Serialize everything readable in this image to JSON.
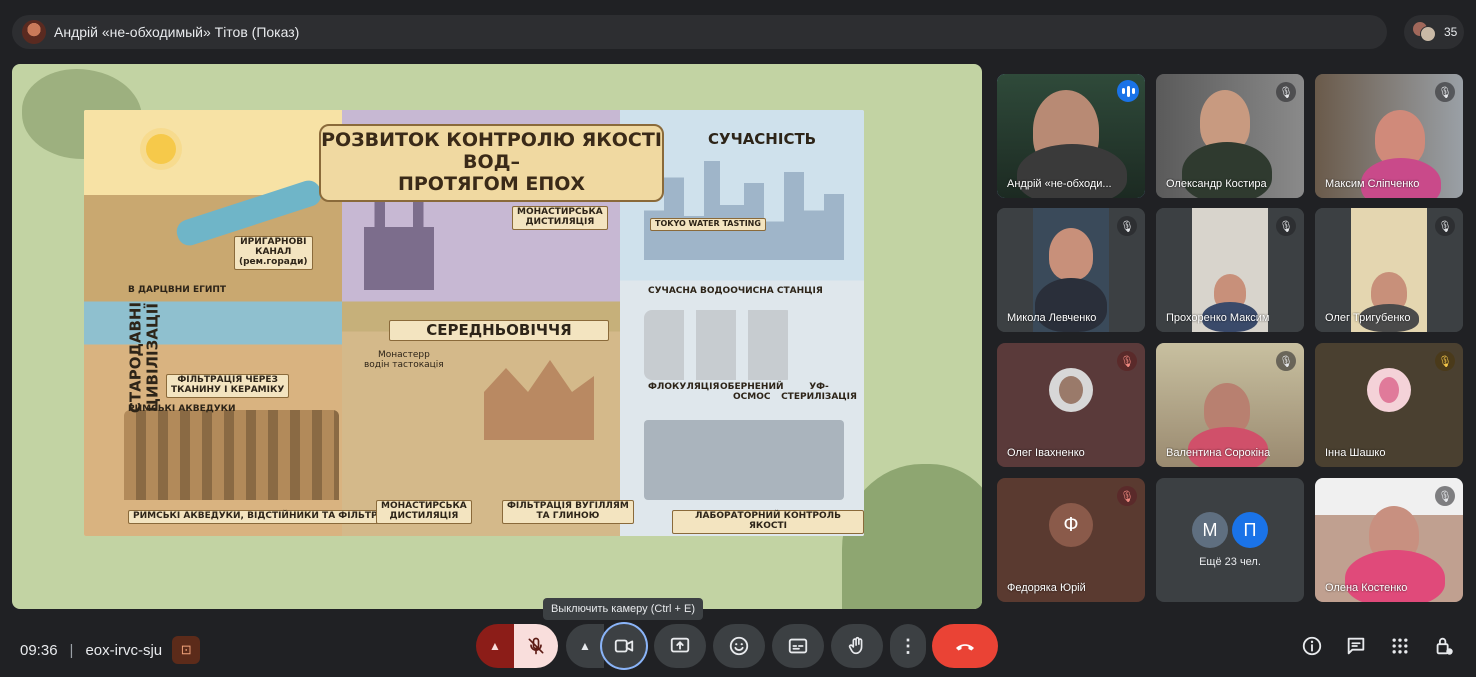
{
  "topbar": {
    "presenter_title": "Андрій «не-обходимый» Тітов (Показ)",
    "participant_count": "35"
  },
  "slide": {
    "title_line1": "РОЗВИТОК КОНТРОЛЮ ЯКОСТІ ВОД–",
    "title_line2": "ПРОТЯГОМ ЕПОХ",
    "section_modern": "СУЧАСНІСТЬ",
    "section_middle": "СЕРЕДНЬОВІЧЧЯ",
    "section_ancient": "СТАРОДАВНІ ЦИВІЛІЗАЦІЇ",
    "labels": {
      "irrigation": "ИРИГАРНОВІ\nКАНАЛ\n(рем.горади)",
      "egypt": "В ДАРЦВНИ ЕГИПТ",
      "filtration_cloth": "ФІЛЬТРАЦІЯ ЧЕРЕЗ\nТКАНИНУ І КЕРАМІКУ",
      "roman_aqueducts": "РИМСЬКІ АКВЕДУКИ",
      "roman_bottom": "РИМСЬКІ АКВЕДУКИ, ВІДСТІЙНИКИ ТА ФІЛЬТРИ",
      "monastic_top": "МОНАСТИРСЬКА\nДИСТИЛЯЦІЯ",
      "monastery_small": "Монастерр\nводін тастокація",
      "monastic_bottom": "МОНАСТИРСЬКА\nДИСТИЛЯЦІЯ",
      "charcoal": "ФІЛЬТРАЦІЯ ВУГІЛЛЯМ\nТА ГЛИНОЮ",
      "tokyo": "TOKYO WATER TASTING",
      "plant": "СУЧАСНА ВОДООЧИСНА СТАНЦІЯ",
      "flocculation": "ФЛОКУЛЯЦІЯ",
      "reverse_osmosis": "ОБЕРНЕНИЙ\nОСМОС",
      "uv": "УФ-СТЕРИЛІЗАЦІЯ",
      "lab_control": "ЛАБОРАТОРНИЙ КОНТРОЛЬ ЯКОСТІ"
    }
  },
  "participants": [
    {
      "name": "Андрій «не-обходи...",
      "state": "speaking"
    },
    {
      "name": "Олександр Костира",
      "state": "muted"
    },
    {
      "name": "Максим Сліпченко",
      "state": "muted"
    },
    {
      "name": "Микола Левченко",
      "state": "muted"
    },
    {
      "name": "Прохоренко Максим",
      "state": "muted"
    },
    {
      "name": "Олег Тригубенко",
      "state": "muted"
    },
    {
      "name": "Олег Івахненко",
      "state": "muted"
    },
    {
      "name": "Валентина Сорокіна",
      "state": "muted"
    },
    {
      "name": "Інна Шашко",
      "state": "muted"
    },
    {
      "name": "Федоряка Юрій",
      "initial": "Ф",
      "state": "muted"
    },
    {
      "more_label": "Ещё 23 чел.",
      "initials": [
        "М",
        "П"
      ]
    },
    {
      "name": "Олена Костенко",
      "state": "muted"
    }
  ],
  "bottom": {
    "time": "09:36",
    "meeting_code": "eox-irvc-sju",
    "tooltip": "Выключить камеру (Ctrl + E)"
  },
  "icons": {
    "mic_off": "mic-off-icon",
    "camera": "videocam-icon",
    "present": "present-screen-icon",
    "emoji": "emoji-icon",
    "captions": "captions-icon",
    "raise_hand": "raise-hand-icon",
    "more": "more-vert-icon",
    "end_call": "call-end-icon",
    "info": "info-icon",
    "chat": "chat-icon",
    "activities": "apps-icon",
    "host_controls": "host-controls-icon"
  },
  "colors": {
    "background": "#202124",
    "accent_blue": "#8ab4f8",
    "end_call_red": "#ea4335",
    "mic_off_pink": "#f9dedc"
  }
}
